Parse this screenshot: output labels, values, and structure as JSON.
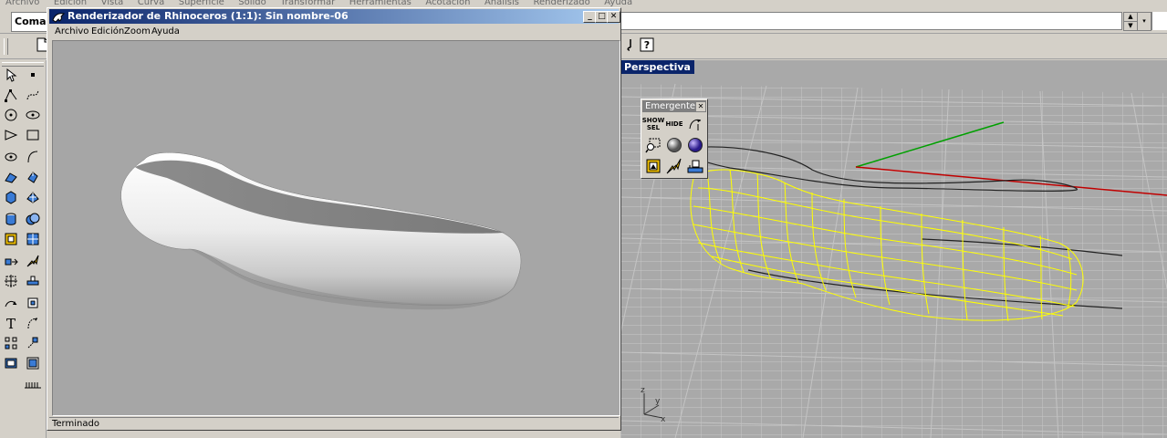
{
  "main_menu": {
    "items": [
      "Archivo",
      "Edición",
      "Vista",
      "Curva",
      "Superficie",
      "Sólido",
      "Transformar",
      "Herramientas",
      "Acotación",
      "Análisis",
      "Renderizado",
      "Ayuda"
    ]
  },
  "command": {
    "label": "Comandos"
  },
  "render_window": {
    "title": "Renderizador de Rhinoceros (1:1): Sin nombre-06",
    "menu": [
      "Archivo",
      "Edición",
      "Zoom",
      "Ayuda"
    ],
    "status": "Terminado"
  },
  "viewport": {
    "title": "Perspectiva",
    "axis_labels": {
      "z": "z",
      "y": "y",
      "x": "x"
    }
  },
  "popup_toolbar": {
    "title": "Emergente",
    "show_sel": "SHOW SEL",
    "hide": "HIDE"
  },
  "colors": {
    "titlebar_active": "#0a246a",
    "wireframe": "#ffff00",
    "axis_x": "#c00000",
    "axis_y": "#00a000",
    "render_background": "#a6a6a6",
    "viewport_background": "#a9a9a9"
  },
  "icons": {
    "toolbar": [
      "new-document-icon",
      "lasso-select-icon",
      "help-icon"
    ],
    "left_toolbar": [
      "select-arrow-icon",
      "point-icon",
      "polyline-icon",
      "curve-icon",
      "circle-icon",
      "ellipse-icon",
      "arc-icon",
      "rectangle-icon",
      "polygon-icon",
      "freeform-curve-icon",
      "surface-icon",
      "extrude-icon",
      "box-icon",
      "mesh-icon",
      "cylinder-icon",
      "boolean-icon",
      "layer-icon",
      "map-icon",
      "move-icon",
      "light-icon",
      "transform-icon",
      "array-icon",
      "dimension-icon",
      "analyze-icon",
      "text-icon",
      "curvature-icon",
      "grid-icon",
      "snap-icon",
      "render-icon",
      "blocks-icon",
      "ruler-icon"
    ],
    "popup": [
      "show-sel-icon",
      "hide-icon",
      "rotate-view-icon",
      "zoom-window-icon",
      "render-sphere-icon",
      "material-sphere-icon",
      "render-preview-icon",
      "light-spark-icon",
      "measure-icon"
    ]
  }
}
